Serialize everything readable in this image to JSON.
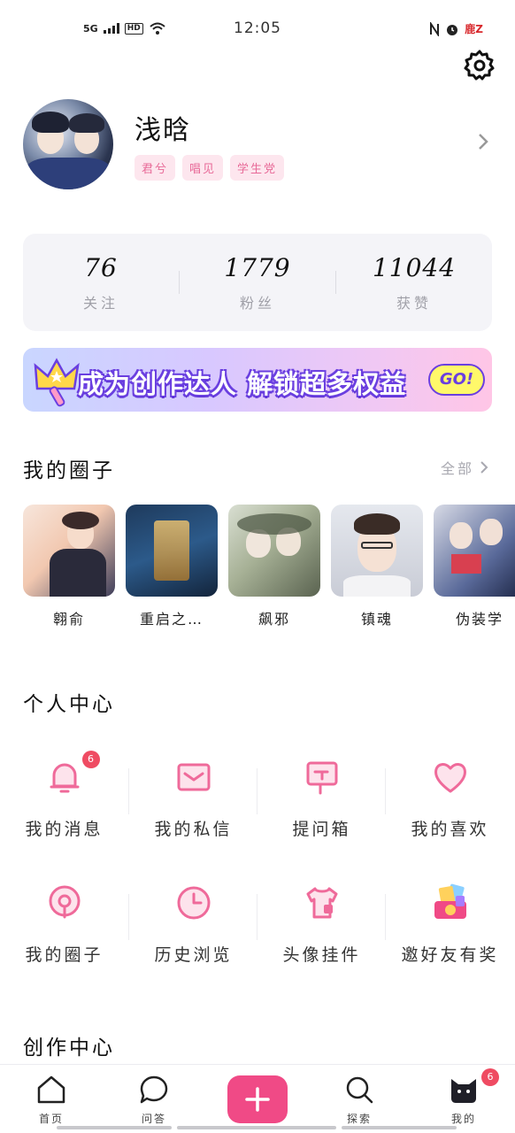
{
  "status_bar": {
    "network": "5G",
    "hd": "HD",
    "time": "12:05",
    "right_text": "鹿Z"
  },
  "profile": {
    "username": "浅晗",
    "tags": [
      "君兮",
      "唱见",
      "学生党"
    ]
  },
  "stats": [
    {
      "value": "76",
      "label": "关注"
    },
    {
      "value": "1779",
      "label": "粉丝"
    },
    {
      "value": "11044",
      "label": "获赞"
    }
  ],
  "banner": {
    "text": "成为创作达人 解锁超多权益",
    "go": "GO!"
  },
  "my_circles": {
    "title": "我的圈子",
    "see_all": "全部",
    "items": [
      {
        "name": "翱俞"
      },
      {
        "name": "重启之…"
      },
      {
        "name": "飙邪"
      },
      {
        "name": "镇魂"
      },
      {
        "name": "伪装学"
      }
    ]
  },
  "personal_center": {
    "title": "个人中心",
    "items": [
      {
        "label": "我的消息",
        "icon": "bell-icon",
        "badge": "6"
      },
      {
        "label": "我的私信",
        "icon": "envelope-icon"
      },
      {
        "label": "提问箱",
        "icon": "mailbox-icon"
      },
      {
        "label": "我的喜欢",
        "icon": "heart-icon"
      },
      {
        "label": "我的圈子",
        "icon": "circle-pin-icon"
      },
      {
        "label": "历史浏览",
        "icon": "clock-icon"
      },
      {
        "label": "头像挂件",
        "icon": "tshirt-icon"
      },
      {
        "label": "邀好友有奖",
        "icon": "gift-icon"
      }
    ]
  },
  "creation_center": {
    "title": "创作中心"
  },
  "bottom_nav": {
    "items": [
      {
        "label": "首页",
        "icon": "home-icon"
      },
      {
        "label": "问答",
        "icon": "chat-bubble-icon"
      },
      {
        "label": "",
        "icon": "plus-icon"
      },
      {
        "label": "探索",
        "icon": "search-icon"
      },
      {
        "label": "我的",
        "icon": "cat-icon",
        "badge": "6"
      }
    ]
  },
  "colors": {
    "accent": "#f04a86",
    "tag_bg": "#fde6ee",
    "badge": "#ef4b62"
  }
}
